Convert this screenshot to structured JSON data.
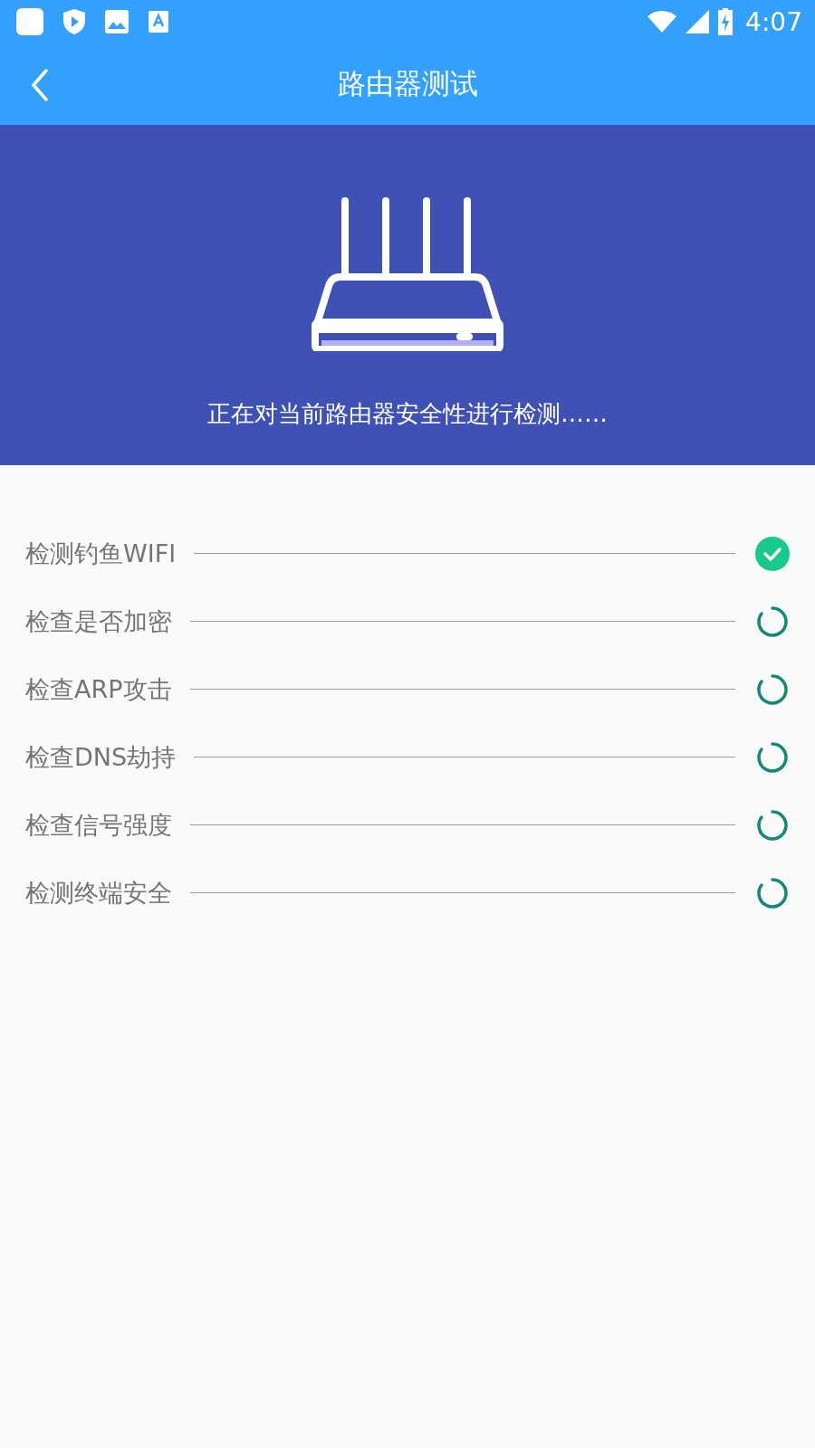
{
  "status_bar": {
    "time": "4:07"
  },
  "app_bar": {
    "title": "路由器测试"
  },
  "banner": {
    "message": "正在对当前路由器安全性进行检测……"
  },
  "checks": [
    {
      "label": "检测钓鱼WIFI",
      "done": true
    },
    {
      "label": "检查是否加密",
      "done": false
    },
    {
      "label": "检查ARP攻击",
      "done": false
    },
    {
      "label": "检查DNS劫持",
      "done": false
    },
    {
      "label": "检查信号强度",
      "done": false
    },
    {
      "label": "检测终端安全",
      "done": false
    }
  ]
}
